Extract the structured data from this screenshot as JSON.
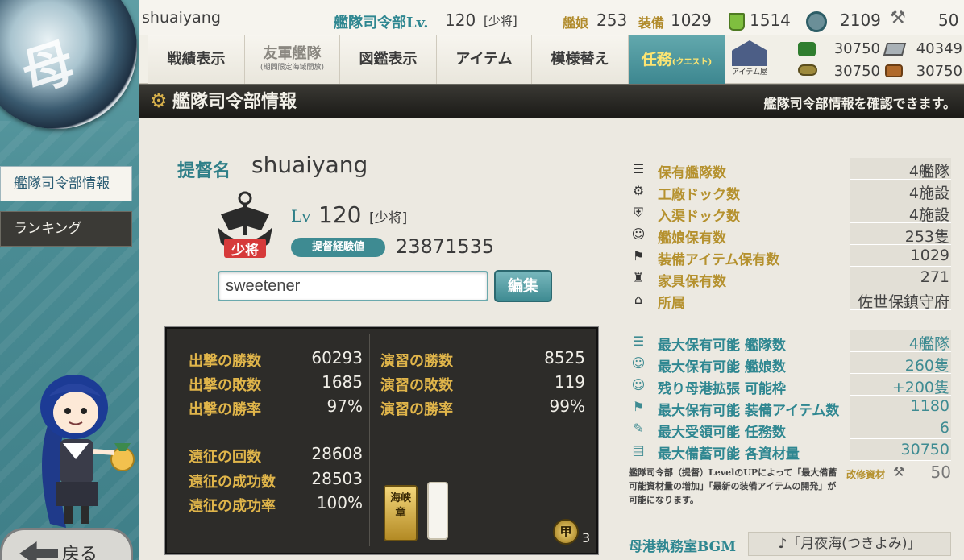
{
  "app": {
    "username": "shuaiyang",
    "hq_label": "艦隊司令部Lv.",
    "hq_level": "120",
    "rank_bracket": "[少将]",
    "kanmusu_label": "艦娘",
    "kanmusu_count": "253",
    "equip_label": "装備",
    "equip_count": "1029",
    "bucket_count": "1514",
    "devmat_count": "2109",
    "screw_count": "50"
  },
  "nav": {
    "items": [
      "戦績表示",
      "友軍艦隊",
      "図鑑表示",
      "アイテム",
      "模様替え",
      "任務"
    ],
    "friend_sub": "(期間限定海域開放)",
    "quest_sub": "(クエスト)",
    "shop_label": "アイテム屋"
  },
  "resources": {
    "fuel": "30750",
    "steel": "40349",
    "ammo": "30750",
    "bauxite": "30750"
  },
  "header": {
    "title": "艦隊司令部情報",
    "subtitle": "艦隊司令部情報を確認できます。"
  },
  "sidebar": {
    "items": [
      "艦隊司令部情報",
      "ランキング"
    ],
    "back_label": "戻る"
  },
  "profile": {
    "name_label": "提督名",
    "name": "shuaiyang",
    "lv_label": "Lv",
    "level": "120",
    "rank_bracket": "[少将]",
    "rank_emblem_text": "少将",
    "xp_label": "提督経験値",
    "xp": "23871535",
    "comment_value": "sweetener",
    "edit_label": "編集"
  },
  "stats": {
    "sortie_wins_label": "出撃の勝数",
    "sortie_wins": "60293",
    "sortie_losses_label": "出撃の敗数",
    "sortie_losses": "1685",
    "sortie_rate_label": "出撃の勝率",
    "sortie_rate": "97%",
    "exercise_wins_label": "演習の勝数",
    "exercise_wins": "8525",
    "exercise_losses_label": "演習の敗数",
    "exercise_losses": "119",
    "exercise_rate_label": "演習の勝率",
    "exercise_rate": "99%",
    "expedition_count_label": "遠征の回数",
    "expedition_count": "28608",
    "expedition_success_label": "遠征の成功数",
    "expedition_success": "28503",
    "expedition_rate_label": "遠征の成功率",
    "expedition_rate": "100%",
    "medal_1": "海峡章",
    "medal_2": "甲",
    "medal_count": "3"
  },
  "info": {
    "rows": [
      {
        "label": "保有艦隊数",
        "value": "4艦隊",
        "icon": "fleet-icon"
      },
      {
        "label": "工廠ドック数",
        "value": "4施設",
        "icon": "gear-icon"
      },
      {
        "label": "入渠ドック数",
        "value": "4施設",
        "icon": "repair-icon"
      },
      {
        "label": "艦娘保有数",
        "value": "253隻",
        "icon": "shipgirl-icon"
      },
      {
        "label": "装備アイテム保有数",
        "value": "1029",
        "icon": "equipment-icon"
      },
      {
        "label": "家具保有数",
        "value": "271",
        "icon": "furniture-icon"
      },
      {
        "label": "所属",
        "value": "佐世保鎮守府",
        "icon": "base-icon"
      }
    ],
    "max_rows": [
      {
        "label": "最大保有可能 艦隊数",
        "value": "4艦隊",
        "icon": "fleet-icon"
      },
      {
        "label": "最大保有可能 艦娘数",
        "value": "260隻",
        "icon": "shipgirl-icon"
      },
      {
        "label": "残り母港拡張 可能枠",
        "value": "+200隻",
        "icon": "shipgirl-icon"
      },
      {
        "label": "最大保有可能 装備アイテム数",
        "value": "1180",
        "icon": "equipment-icon"
      },
      {
        "label": "最大受領可能 任務数",
        "value": "6",
        "icon": "quill-icon"
      },
      {
        "label": "最大備蓄可能 各資材量",
        "value": "30750",
        "icon": "box-icon"
      }
    ],
    "note": "艦隊司令部（提督）LevelのUPによって「最大備蓄可能資材量の増加」「最新の装備アイテムの開発」が可能になります。",
    "improve_label": "改修資材",
    "improve_value": "50",
    "bgm_label": "母港執務室BGM",
    "bgm_value": "♪「月夜海(つきよみ)」"
  }
}
